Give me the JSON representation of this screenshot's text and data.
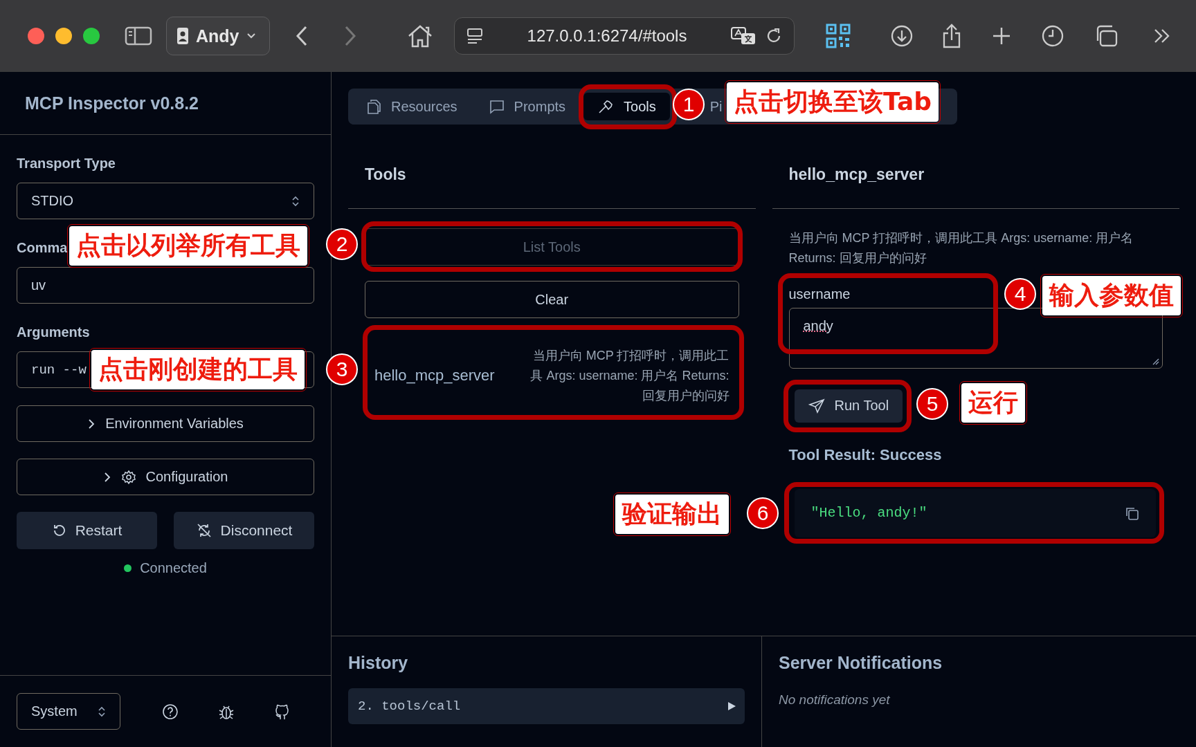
{
  "browser": {
    "profile": "Andy",
    "url": "127.0.0.1:6274/#tools"
  },
  "sidebar": {
    "title": "MCP Inspector v0.8.2",
    "transport_label": "Transport Type",
    "transport_value": "STDIO",
    "command_label": "Comma",
    "command_value": "uv",
    "arguments_label": "Arguments",
    "arguments_value": "run --w",
    "env_button": "Environment Variables",
    "config_button": "Configuration",
    "restart_button": "Restart",
    "disconnect_button": "Disconnect",
    "status": "Connected",
    "connected": true,
    "theme": "System"
  },
  "tabs": [
    {
      "label": "Resources",
      "kind": "resources",
      "selected": false
    },
    {
      "label": "Prompts",
      "kind": "prompts",
      "selected": false
    },
    {
      "label": "Tools",
      "kind": "tools",
      "selected": true
    },
    {
      "label": "Pi",
      "kind": "plain",
      "selected": false
    }
  ],
  "tools_panel": {
    "title": "Tools",
    "list_button": {
      "label": "List Tools",
      "disabled": true
    },
    "clear_button": "Clear",
    "items": [
      {
        "name": "hello_mcp_server",
        "description": "当用户向 MCP 打招呼时，调用此工具 Args: username: 用户名 Returns: 回复用户的问好"
      }
    ]
  },
  "detail": {
    "title": "hello_mcp_server",
    "description": "当用户向 MCP 打招呼时，调用此工具 Args: username: 用户名 Returns: 回复用户的问好",
    "param_label": "username",
    "param_value": "andy",
    "run_button": "Run Tool",
    "result_title": "Tool Result: Success",
    "result": "\"Hello, andy!\""
  },
  "history": {
    "title": "History",
    "items": [
      {
        "label": "2. tools/call"
      }
    ]
  },
  "notifications": {
    "title": "Server Notifications",
    "empty": "No notifications yet"
  },
  "annotations": [
    {
      "number": "1",
      "label": "点击切换至该Tab"
    },
    {
      "number": "2",
      "label": "点击以列举所有工具"
    },
    {
      "number": "3",
      "label": "点击刚创建的工具"
    },
    {
      "number": "4",
      "label": "输入参数值"
    },
    {
      "number": "5",
      "label": "运行"
    },
    {
      "number": "6",
      "label": "验证输出"
    }
  ]
}
